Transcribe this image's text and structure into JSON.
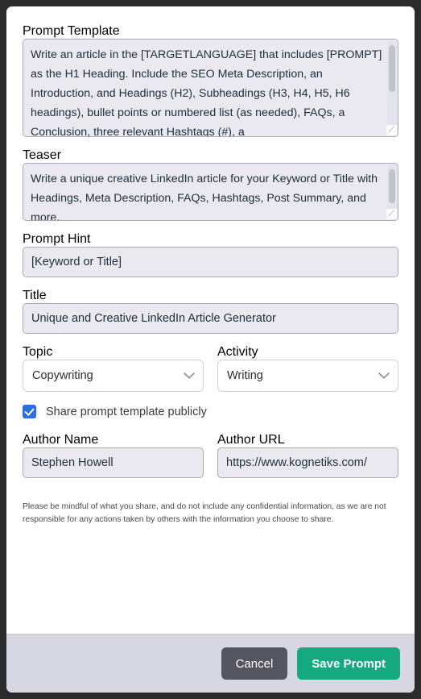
{
  "form": {
    "prompt_template": {
      "label": "Prompt Template",
      "value": "Write an article in the [TARGETLANGUAGE] that includes [PROMPT] as the H1 Heading. Include the SEO Meta Description, an Introduction, and Headings (H2), Subheadings (H3, H4, H5, H6 headings), bullet points or numbered list (as needed), FAQs, a Conclusion, three relevant Hashtags (#), a"
    },
    "teaser": {
      "label": "Teaser",
      "value": "Write a unique creative LinkedIn article for your Keyword or Title with Headings, Meta Description, FAQs, Hashtags, Post Summary, and more."
    },
    "prompt_hint": {
      "label": "Prompt Hint",
      "value": "[Keyword or Title]",
      "placeholder": "[Keyword or Title]"
    },
    "title": {
      "label": "Title",
      "value": "Unique and Creative LinkedIn Article Generator",
      "placeholder": "Title"
    },
    "topic": {
      "label": "Topic",
      "value": "Copywriting",
      "icon": "chevron-down-icon"
    },
    "activity": {
      "label": "Activity",
      "value": "Writing",
      "icon": "chevron-down-icon"
    },
    "share_publicly": {
      "label": "Share prompt template publicly",
      "checked": true,
      "icon": "check-icon"
    },
    "author_name": {
      "label": "Author Name",
      "value": "Stephen Howell",
      "placeholder": "Author Name"
    },
    "author_url": {
      "label": "Author URL",
      "value": "https://www.kognetiks.com/",
      "placeholder": "Author URL"
    },
    "disclaimer": "Please be mindful of what you share, and do not include any confidential information, as we are not responsible for any actions taken by others with the information you choose to share."
  },
  "footer": {
    "cancel_label": "Cancel",
    "save_label": "Save Prompt"
  },
  "colors": {
    "accent_green": "#15a97f",
    "cancel_gray": "#555562",
    "checkbox_blue": "#2a6fe0",
    "input_bg": "#e9e9ef",
    "footer_bg": "#d6d7e0"
  }
}
